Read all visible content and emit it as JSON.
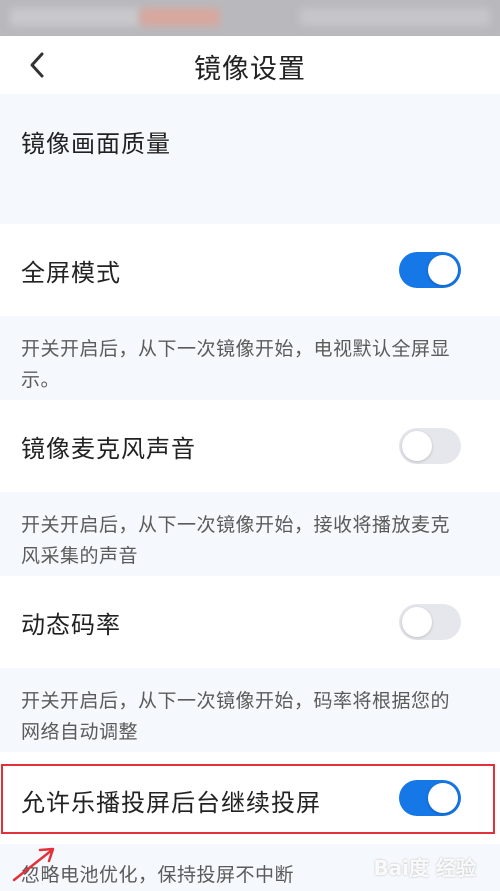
{
  "header": {
    "title": "镜像设置",
    "back_icon": "chevron-left-icon"
  },
  "sections": {
    "quality": {
      "label": "镜像画面质量"
    },
    "fullscreen": {
      "label": "全屏模式",
      "enabled": true,
      "description": "开关开启后，从下一次镜像开始，电视默认全屏显示。"
    },
    "mic_sound": {
      "label": "镜像麦克风声音",
      "enabled": false,
      "description": "开关开启后，从下一次镜像开始，接收将播放麦克风采集的声音"
    },
    "dynamic_bitrate": {
      "label": "动态码率",
      "enabled": false,
      "description": "开关开启后，从下一次镜像开始，码率将根据您的网络自动调整"
    },
    "background_cast": {
      "label": "允许乐播投屏后台继续投屏",
      "enabled": true,
      "description": "忽略电池优化，保持投屏不中断"
    }
  },
  "colors": {
    "toggle_on": "#1677e6",
    "toggle_off": "#e6e7ec",
    "highlight": "#e3313a"
  }
}
